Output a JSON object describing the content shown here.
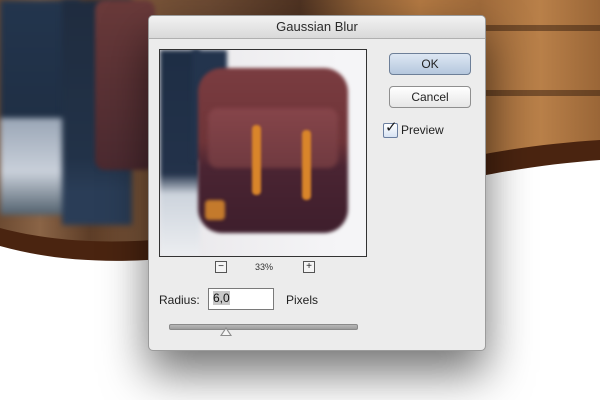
{
  "dialog": {
    "title": "Gaussian Blur",
    "zoom": "33%",
    "buttons": {
      "ok": "OK",
      "cancel": "Cancel"
    },
    "preview": {
      "label": "Preview",
      "checked": true
    },
    "radius": {
      "label": "Radius:",
      "value": "6,0",
      "units": "Pixels"
    },
    "slider_level": 0.3
  },
  "colors": {
    "dialog_bg": "#ececec",
    "wave_brown": "#4a2410"
  },
  "icons": {
    "zoom_out": "minus-icon",
    "zoom_in": "plus-icon",
    "checkbox": "checkmark-icon"
  }
}
